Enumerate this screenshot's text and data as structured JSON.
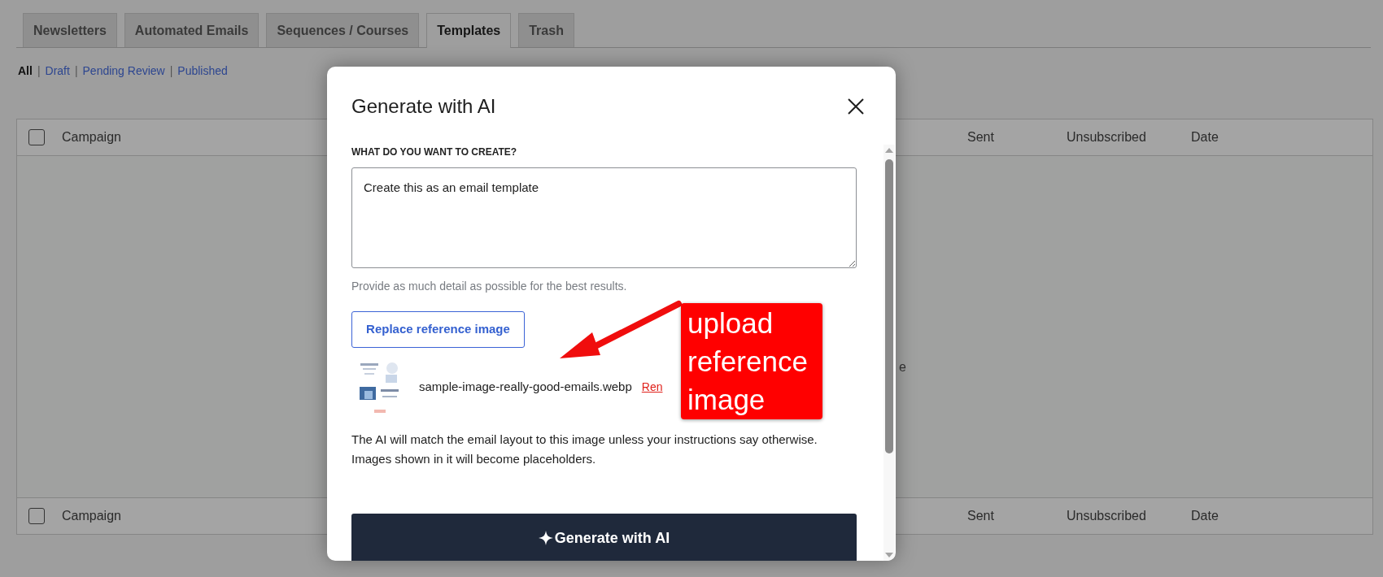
{
  "tabs": [
    {
      "label": "Newsletters",
      "selected": false
    },
    {
      "label": "Automated Emails",
      "selected": false
    },
    {
      "label": "Sequences / Courses",
      "selected": false
    },
    {
      "label": "Templates",
      "selected": true
    },
    {
      "label": "Trash",
      "selected": false
    }
  ],
  "filters": [
    {
      "label": "All",
      "selected": true,
      "separator": "|"
    },
    {
      "label": "Draft",
      "selected": false,
      "separator": "|"
    },
    {
      "label": "Pending Review",
      "selected": false,
      "separator": "|"
    },
    {
      "label": "Published",
      "selected": false
    }
  ],
  "table": {
    "header": {
      "checked": false,
      "columns": [
        "Campaign",
        "Sent",
        "Unsubscribed",
        "Date"
      ]
    },
    "footer": {
      "checked": false,
      "columns": [
        "Campaign",
        "Sent",
        "Unsubscribed",
        "Date"
      ]
    },
    "background_text": "e"
  },
  "modal": {
    "title": "Generate with AI",
    "prompt_label": "WHAT DO YOU WANT TO CREATE?",
    "prompt_value": "Create this as an email template",
    "helper": "Provide as much detail as possible for the best results.",
    "replace_button": "Replace reference image",
    "attachment": {
      "file_name": "sample-image-really-good-emails.webp",
      "remove_link": "Ren"
    },
    "note": "The AI will match the email layout to this image unless your instructions say otherwise. Images shown in it will become placeholders.",
    "generate_button": "Generate with AI"
  },
  "annotation": {
    "text": "upload reference image"
  }
}
